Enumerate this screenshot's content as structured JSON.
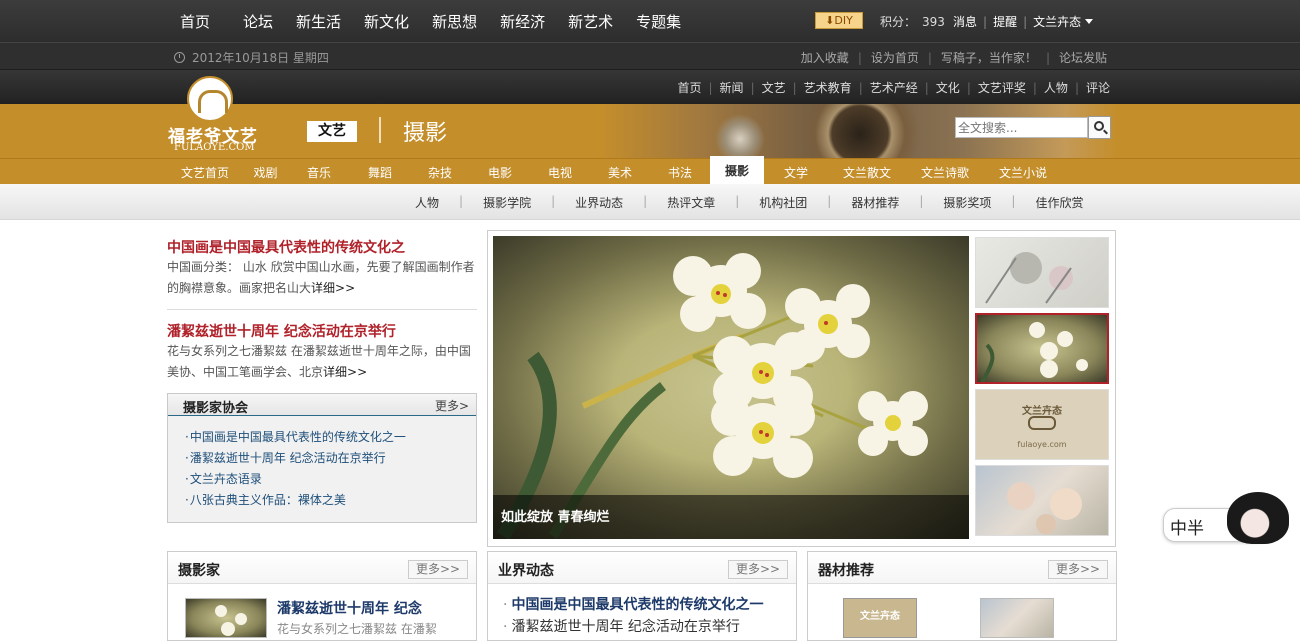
{
  "topnav": [
    "首页",
    "论坛",
    "新生活",
    "新文化",
    "新思想",
    "新经济",
    "新艺术",
    "专题集"
  ],
  "diy_label": "DIY",
  "points_label": "积分：",
  "points_value": "393",
  "user": {
    "messages": "消息",
    "alerts": "提醒",
    "username": "文兰卉态"
  },
  "date_text": "2012年10月18日 星期四",
  "sublinks": [
    "加入收藏",
    "设为首页",
    "写稿子，当作家！",
    "论坛发贴"
  ],
  "channel_links": [
    "首页",
    "新闻",
    "文艺",
    "艺术教育",
    "艺术产经",
    "文化",
    "文艺评奖",
    "人物",
    "评论"
  ],
  "logo": {
    "cn": "福老爷文艺",
    "en": "FULAOYE.COM"
  },
  "banner": {
    "tag": "文艺",
    "title": "摄影"
  },
  "search": {
    "placeholder": "全文搜索..."
  },
  "channels": [
    "文艺首页",
    "戏剧",
    "音乐",
    "舞蹈",
    "杂技",
    "电影",
    "电视",
    "美术",
    "书法",
    "摄影",
    "文学",
    "文兰散文",
    "文兰诗歌",
    "文兰小说"
  ],
  "active_channel": "摄影",
  "subcats": [
    "人物",
    "摄影学院",
    "业界动态",
    "热评文章",
    "机构社团",
    "器材推荐",
    "摄影奖项",
    "佳作欣赏"
  ],
  "articles": [
    {
      "title": "中国画是中国最具代表性的传统文化之",
      "desc": "中国画分类：  山水      欣赏中国山水画，先要了解国画制作者的胸襟意象。画家把名山大",
      "more": "详细>>"
    },
    {
      "title": "潘絜兹逝世十周年  纪念活动在京举行",
      "desc": "花与女系列之七潘絜兹      在潘絜兹逝世十周年之际，由中国美协、中国工笔画学会、北京",
      "more": "详细>>"
    }
  ],
  "assoc": {
    "title": "摄影家协会",
    "more": "更多>",
    "items": [
      "中国画是中国最具代表性的传统文化之一",
      "潘絜兹逝世十周年  纪念活动在京举行",
      "文兰卉态语录",
      "八张古典主义作品：裸体之美"
    ]
  },
  "slider_caption": "如此绽放  青春绚烂",
  "thumb_text": {
    "t3a": "文兰卉态",
    "t3b": "fulaoye.com"
  },
  "boxes": [
    {
      "title": "摄影家",
      "more": "更多>>",
      "item_title": "潘絜兹逝世十周年  纪念",
      "item_desc": "花与女系列之七潘絜兹      在潘絜"
    },
    {
      "title": "业界动态",
      "more": "更多>>",
      "items": [
        "中国画是中国最具代表性的传统文化之一",
        "潘絜兹逝世十周年  纪念活动在京举行"
      ]
    },
    {
      "title": "器材推荐",
      "more": "更多>>",
      "thumb_text": "文兰卉态"
    }
  ],
  "float_text": "中半"
}
